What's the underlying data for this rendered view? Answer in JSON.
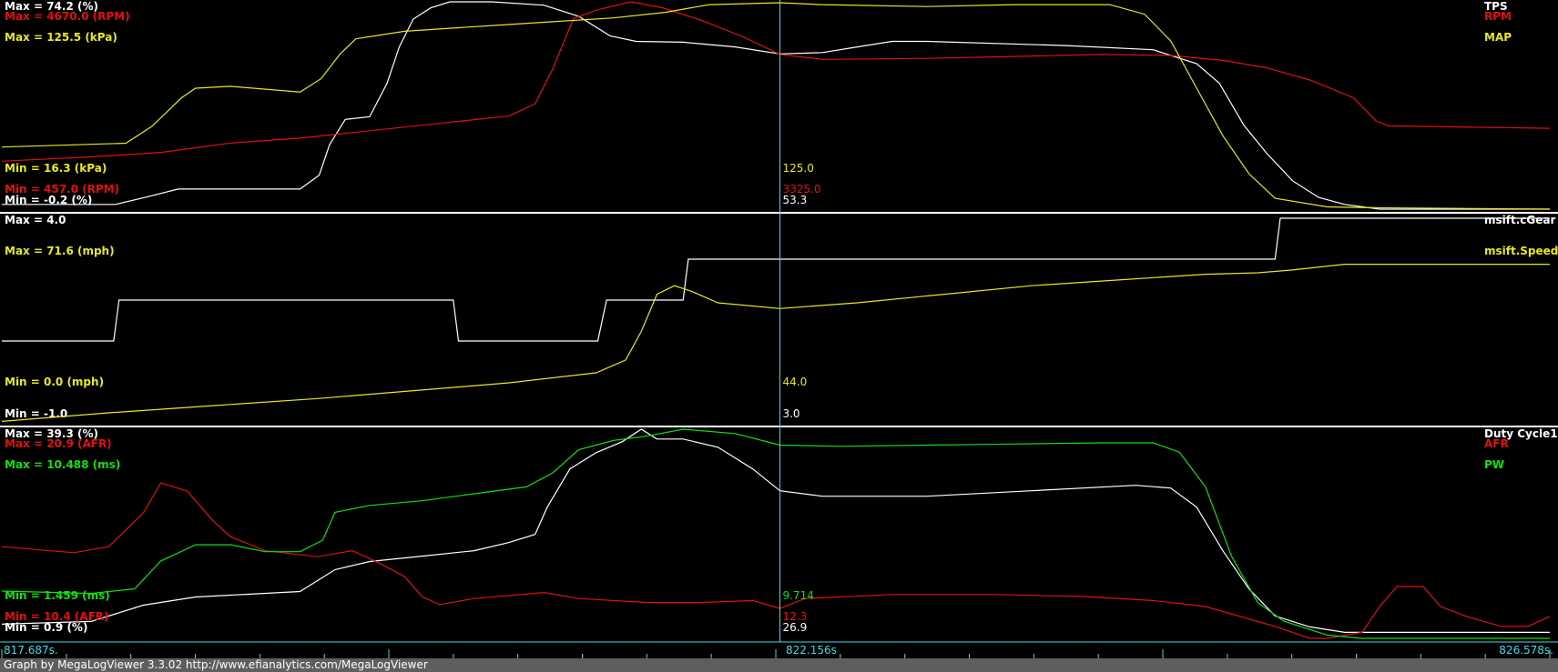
{
  "footer": "Graph by MegaLogViewer 3.3.02 http://www.efianalytics.com/MegaLogViewer",
  "time_axis": {
    "start": "817.687s.",
    "cursor": "822.156s",
    "end": "826.578s."
  },
  "colors": {
    "white": "#ffffff",
    "red": "#e01010",
    "yellow": "#e8e820",
    "green": "#10e010",
    "cursor": "#45d8e8"
  },
  "chart_data": [
    {
      "type": "line",
      "x_range": [
        817.687,
        826.578
      ],
      "cursor_x": 822.156,
      "series": [
        {
          "name": "TPS",
          "color": "white",
          "max_label": "Max = 74.2 (%)",
          "min_label": "Min = -0.2 (%)",
          "cursor_value": "53.3",
          "ylim": [
            -0.2,
            74.2
          ],
          "points": [
            [
              817.687,
              1.5
            ],
            [
              818.34,
              1.5
            ],
            [
              818.51,
              4.0
            ],
            [
              818.7,
              7.0
            ],
            [
              819.0,
              7.0
            ],
            [
              819.4,
              7.0
            ],
            [
              819.51,
              12
            ],
            [
              819.57,
              23
            ],
            [
              819.66,
              32
            ],
            [
              819.8,
              33
            ],
            [
              819.9,
              45
            ],
            [
              819.97,
              58
            ],
            [
              820.05,
              68
            ],
            [
              820.15,
              72
            ],
            [
              820.26,
              74.2
            ],
            [
              820.5,
              74.2
            ],
            [
              820.8,
              73
            ],
            [
              821.0,
              69
            ],
            [
              821.18,
              62
            ],
            [
              821.33,
              60
            ],
            [
              821.6,
              59.7
            ],
            [
              821.9,
              58
            ],
            [
              822.156,
              55.5
            ],
            [
              822.4,
              56
            ],
            [
              822.6,
              58
            ],
            [
              822.8,
              60
            ],
            [
              823.0,
              60
            ],
            [
              823.8,
              58.5
            ],
            [
              824.3,
              57
            ],
            [
              824.55,
              52
            ],
            [
              824.68,
              45
            ],
            [
              824.82,
              30
            ],
            [
              824.95,
              20
            ],
            [
              825.1,
              10
            ],
            [
              825.25,
              4
            ],
            [
              825.4,
              1.5
            ],
            [
              825.6,
              -0.2
            ],
            [
              826.578,
              -0.2
            ]
          ]
        },
        {
          "name": "RPM",
          "color": "red",
          "max_label": "Max = 4670.0 (RPM)",
          "min_label": "Min = 457.0 (RPM)",
          "cursor_value": "3325.0",
          "ylim": [
            457.0,
            4670.0
          ],
          "points": [
            [
              817.687,
              1430
            ],
            [
              818.2,
              1520
            ],
            [
              818.6,
              1610
            ],
            [
              819.0,
              1800
            ],
            [
              819.4,
              1900
            ],
            [
              819.8,
              2050
            ],
            [
              820.2,
              2200
            ],
            [
              820.6,
              2350
            ],
            [
              820.75,
              2600
            ],
            [
              820.85,
              3300
            ],
            [
              820.97,
              4330
            ],
            [
              821.1,
              4500
            ],
            [
              821.3,
              4670
            ],
            [
              821.48,
              4550
            ],
            [
              821.7,
              4300
            ],
            [
              821.95,
              3950
            ],
            [
              822.156,
              3600
            ],
            [
              822.4,
              3500
            ],
            [
              823.0,
              3520
            ],
            [
              823.5,
              3560
            ],
            [
              824.0,
              3600
            ],
            [
              824.4,
              3580
            ],
            [
              824.7,
              3480
            ],
            [
              824.95,
              3330
            ],
            [
              825.2,
              3080
            ],
            [
              825.45,
              2720
            ],
            [
              825.58,
              2250
            ],
            [
              825.65,
              2150
            ],
            [
              826.578,
              2100
            ]
          ]
        },
        {
          "name": "MAP",
          "color": "yellow",
          "max_label": "Max = 125.5 (kPa)",
          "min_label": "Min = 16.3 (kPa)",
          "cursor_value": "125.0",
          "ylim": [
            16.3,
            125.5
          ],
          "points": [
            [
              817.687,
              49
            ],
            [
              818.4,
              51
            ],
            [
              818.55,
              60
            ],
            [
              818.72,
              75
            ],
            [
              818.8,
              80
            ],
            [
              819.0,
              81
            ],
            [
              819.4,
              78
            ],
            [
              819.52,
              85
            ],
            [
              819.63,
              98
            ],
            [
              819.72,
              106
            ],
            [
              820.0,
              110
            ],
            [
              820.5,
              113
            ],
            [
              820.85,
              115
            ],
            [
              821.2,
              117
            ],
            [
              821.5,
              120
            ],
            [
              821.75,
              124
            ],
            [
              822.156,
              125
            ],
            [
              822.4,
              124
            ],
            [
              823.0,
              123
            ],
            [
              823.5,
              124
            ],
            [
              824.05,
              124
            ],
            [
              824.25,
              119
            ],
            [
              824.4,
              105
            ],
            [
              824.55,
              80
            ],
            [
              824.7,
              55
            ],
            [
              824.85,
              35
            ],
            [
              825.0,
              22
            ],
            [
              825.3,
              17.5
            ],
            [
              825.6,
              17
            ],
            [
              826.578,
              16.3
            ]
          ]
        }
      ]
    },
    {
      "type": "line",
      "x_range": [
        817.687,
        826.578
      ],
      "cursor_x": 822.156,
      "series": [
        {
          "name": "msift.cGear",
          "color": "white",
          "max_label": "Max = 4.0",
          "min_label": "Min = -1.0",
          "cursor_value": "3.0",
          "ylim": [
            -1.0,
            4.0
          ],
          "points": [
            [
              817.687,
              1.0
            ],
            [
              818.33,
              1.0
            ],
            [
              818.36,
              2.0
            ],
            [
              820.28,
              2.0
            ],
            [
              820.31,
              1.0
            ],
            [
              821.11,
              1.0
            ],
            [
              821.16,
              2.0
            ],
            [
              821.6,
              2.0
            ],
            [
              821.63,
              3.0
            ],
            [
              825.0,
              3.0
            ],
            [
              825.03,
              4.0
            ],
            [
              826.578,
              4.0
            ]
          ]
        },
        {
          "name": "msift.Speed",
          "color": "yellow",
          "max_label": "Max = 71.6 (mph)",
          "min_label": "Min = 0.0 (mph)",
          "cursor_value": "44.0",
          "ylim": [
            0.0,
            71.6
          ],
          "points": [
            [
              817.687,
              0.5
            ],
            [
              818.3,
              3.5
            ],
            [
              818.9,
              6.0
            ],
            [
              819.5,
              8.5
            ],
            [
              820.1,
              11.5
            ],
            [
              820.6,
              14.0
            ],
            [
              821.1,
              17.5
            ],
            [
              821.27,
              22
            ],
            [
              821.36,
              32
            ],
            [
              821.45,
              45
            ],
            [
              821.55,
              48
            ],
            [
              821.65,
              46
            ],
            [
              821.8,
              42
            ],
            [
              822.156,
              40
            ],
            [
              822.6,
              42
            ],
            [
              823.1,
              45
            ],
            [
              823.6,
              48
            ],
            [
              824.1,
              50
            ],
            [
              824.6,
              52
            ],
            [
              824.9,
              52.5
            ],
            [
              825.1,
              53.5
            ],
            [
              825.4,
              55.5
            ],
            [
              826.578,
              55.5
            ]
          ]
        }
      ]
    },
    {
      "type": "line",
      "x_range": [
        817.687,
        826.578
      ],
      "cursor_x": 822.156,
      "series": [
        {
          "name": "Duty Cycle1",
          "color": "white",
          "max_label": "Max = 39.3 (%)",
          "min_label": "Min = 0.9 (%)",
          "cursor_value": "26.9",
          "ylim": [
            0.9,
            39.3
          ],
          "points": [
            [
              817.687,
              3.5
            ],
            [
              818.2,
              4.0
            ],
            [
              818.5,
              7.0
            ],
            [
              818.8,
              8.5
            ],
            [
              819.1,
              9.0
            ],
            [
              819.4,
              9.5
            ],
            [
              819.6,
              13.5
            ],
            [
              819.8,
              15.0
            ],
            [
              820.1,
              16.0
            ],
            [
              820.4,
              17.0
            ],
            [
              820.6,
              18.5
            ],
            [
              820.75,
              20.0
            ],
            [
              820.82,
              25.0
            ],
            [
              820.95,
              32.0
            ],
            [
              821.1,
              35.0
            ],
            [
              821.25,
              37.0
            ],
            [
              821.36,
              39.3
            ],
            [
              821.45,
              37.5
            ],
            [
              821.6,
              37.5
            ],
            [
              821.8,
              36.0
            ],
            [
              822.0,
              32.0
            ],
            [
              822.156,
              28.0
            ],
            [
              822.4,
              27.0
            ],
            [
              823.0,
              27.0
            ],
            [
              823.6,
              28.0
            ],
            [
              824.2,
              29.0
            ],
            [
              824.4,
              28.5
            ],
            [
              824.55,
              25.0
            ],
            [
              824.7,
              17.0
            ],
            [
              824.85,
              10.0
            ],
            [
              825.0,
              5.0
            ],
            [
              825.2,
              3.0
            ],
            [
              825.4,
              2.0
            ],
            [
              826.578,
              2.0
            ]
          ]
        },
        {
          "name": "AFR",
          "color": "red",
          "max_label": "Max = 20.9 (AFR)",
          "min_label": "Min = 10.4 (AFR)",
          "cursor_value": "12.3",
          "ylim": [
            10.4,
            20.9
          ],
          "points": [
            [
              817.687,
              15.0
            ],
            [
              818.1,
              14.7
            ],
            [
              818.3,
              15.0
            ],
            [
              818.5,
              16.7
            ],
            [
              818.6,
              18.2
            ],
            [
              818.75,
              17.8
            ],
            [
              818.9,
              16.3
            ],
            [
              819.0,
              15.5
            ],
            [
              819.2,
              14.8
            ],
            [
              819.5,
              14.5
            ],
            [
              819.7,
              14.8
            ],
            [
              819.85,
              14.2
            ],
            [
              820.0,
              13.5
            ],
            [
              820.1,
              12.5
            ],
            [
              820.2,
              12.1
            ],
            [
              820.4,
              12.4
            ],
            [
              820.8,
              12.7
            ],
            [
              821.0,
              12.4
            ],
            [
              821.4,
              12.2
            ],
            [
              821.7,
              12.2
            ],
            [
              822.0,
              12.3
            ],
            [
              822.156,
              11.9
            ],
            [
              822.3,
              12.4
            ],
            [
              822.8,
              12.6
            ],
            [
              823.4,
              12.6
            ],
            [
              823.9,
              12.5
            ],
            [
              824.3,
              12.3
            ],
            [
              824.6,
              12.0
            ],
            [
              825.0,
              11.0
            ],
            [
              825.2,
              10.4
            ],
            [
              825.3,
              10.4
            ],
            [
              825.5,
              10.7
            ],
            [
              825.6,
              12.0
            ],
            [
              825.7,
              13.0
            ],
            [
              825.85,
              13.0
            ],
            [
              825.95,
              12.0
            ],
            [
              826.1,
              11.5
            ],
            [
              826.3,
              11.0
            ],
            [
              826.45,
              11.0
            ],
            [
              826.578,
              11.5
            ]
          ]
        },
        {
          "name": "PW",
          "color": "green",
          "max_label": "Max = 10.488 (ms)",
          "min_label": "Min = 1.459 (ms)",
          "cursor_value": "9.714",
          "ylim": [
            1.459,
            10.488
          ],
          "points": [
            [
              817.687,
              3.5
            ],
            [
              818.2,
              3.4
            ],
            [
              818.45,
              3.6
            ],
            [
              818.6,
              4.8
            ],
            [
              818.8,
              5.5
            ],
            [
              819.0,
              5.5
            ],
            [
              819.2,
              5.2
            ],
            [
              819.4,
              5.2
            ],
            [
              819.53,
              5.7
            ],
            [
              819.6,
              6.9
            ],
            [
              819.8,
              7.2
            ],
            [
              820.1,
              7.4
            ],
            [
              820.4,
              7.7
            ],
            [
              820.7,
              8.0
            ],
            [
              820.85,
              8.6
            ],
            [
              821.0,
              9.6
            ],
            [
              821.2,
              10.0
            ],
            [
              821.4,
              10.2
            ],
            [
              821.6,
              10.488
            ],
            [
              821.9,
              10.3
            ],
            [
              822.156,
              9.8
            ],
            [
              822.5,
              9.75
            ],
            [
              823.0,
              9.8
            ],
            [
              823.5,
              9.85
            ],
            [
              824.0,
              9.9
            ],
            [
              824.3,
              9.9
            ],
            [
              824.45,
              9.5
            ],
            [
              824.6,
              8.0
            ],
            [
              824.75,
              5.0
            ],
            [
              824.9,
              3.0
            ],
            [
              825.05,
              2.2
            ],
            [
              825.3,
              1.6
            ],
            [
              825.5,
              1.459
            ],
            [
              826.578,
              1.459
            ]
          ]
        }
      ]
    }
  ]
}
